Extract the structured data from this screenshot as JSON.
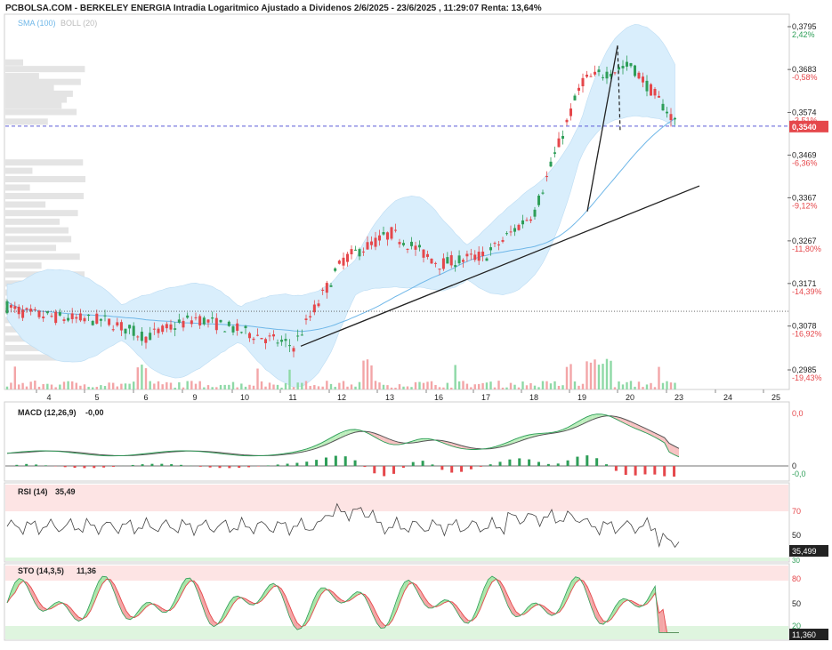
{
  "header": {
    "title": "PCBOLSA.COM - BERKELEY ENERGIA Intradia Logaritmico Ajustado a Dividenos 2/6/2025 - 23/6/2025 , 11:29:07 Renta: 13,64%",
    "sma_label": "SMA (100)",
    "boll_label": "BOLL (20)"
  },
  "colors": {
    "up": "#2e9e58",
    "down": "#e5474b",
    "boll_fill": "#d9eefc",
    "sma": "#6fb7e8",
    "negative_text": "#e5474b",
    "positive_text": "#2e9e58",
    "price_badge": "#e5474b"
  },
  "price_axis": {
    "ticks": [
      {
        "price": "0,3795",
        "pct": "2,42%",
        "sign": "pos",
        "value": 0.3795
      },
      {
        "price": "0,3683",
        "pct": "-0,58%",
        "sign": "neg",
        "value": 0.3683
      },
      {
        "price": "0,3574",
        "pct": "-3,51%",
        "sign": "neg",
        "value": 0.3574
      },
      {
        "price": "0,3469",
        "pct": "-6,36%",
        "sign": "neg",
        "value": 0.3469
      },
      {
        "price": "0,3367",
        "pct": "-9,12%",
        "sign": "neg",
        "value": 0.3367
      },
      {
        "price": "0,3267",
        "pct": "-11,80%",
        "sign": "neg",
        "value": 0.3267
      },
      {
        "price": "0,3171",
        "pct": "-14,39%",
        "sign": "neg",
        "value": 0.3171
      },
      {
        "price": "0,3078",
        "pct": "-16,92%",
        "sign": "neg",
        "value": 0.3078
      },
      {
        "price": "0,2985",
        "pct": "-19,43%",
        "sign": "neg",
        "value": 0.2985
      }
    ],
    "last_price_label": "0,3540",
    "last_price": 0.354
  },
  "x_axis": {
    "labels": [
      "4",
      "5",
      "6",
      "9",
      "10",
      "11",
      "12",
      "13",
      "16",
      "17",
      "18",
      "19",
      "20",
      "23",
      "24",
      "25"
    ]
  },
  "macd": {
    "label": "MACD (12,26,9)",
    "value": "-0,00",
    "axis_top": "0,0",
    "axis_zero": "0",
    "badge": "-0,0"
  },
  "rsi": {
    "label": "RSI (14)",
    "value": "35,49",
    "level_70": "70",
    "level_50": "50",
    "level_30": "30",
    "badge": "35,499"
  },
  "sto": {
    "label": "STO (14,3,5)",
    "value": "11,36",
    "level_80": "80",
    "level_50": "50",
    "level_20": "20",
    "badge": "11,360"
  },
  "chart_data": [
    {
      "type": "candlestick",
      "title": "PCBOLSA.COM - BERKELEY ENERGIA Intradia Logaritmico Ajustado a Dividenos 2/6/2025 - 23/6/2025 , 11:29:07 Renta: 13,64%",
      "scale": "log",
      "ylim": [
        0.2985,
        0.3795
      ],
      "x_categories": [
        "4",
        "5",
        "6",
        "9",
        "10",
        "11",
        "12",
        "13",
        "16",
        "17",
        "18",
        "19",
        "20",
        "23",
        "24",
        "25"
      ],
      "last_price": 0.354,
      "reference_line": 0.311,
      "session_path": [
        {
          "x": "3",
          "close": 0.312
        },
        {
          "x": "4",
          "close": 0.3105
        },
        {
          "x": "5",
          "close": 0.3095
        },
        {
          "x": "6",
          "close": 0.309
        },
        {
          "x": "9",
          "close": 0.3055
        },
        {
          "x": "10",
          "close": 0.3095
        },
        {
          "x": "11",
          "close": 0.3065
        },
        {
          "x": "12",
          "close": 0.3035
        },
        {
          "x": "13",
          "close": 0.3225
        },
        {
          "x": "16",
          "close": 0.3285
        },
        {
          "x": "17",
          "close": 0.3215
        },
        {
          "x": "18",
          "close": 0.3235
        },
        {
          "x": "19",
          "close": 0.3335
        },
        {
          "x": "20",
          "close": 0.3655
        },
        {
          "x": "23",
          "close": 0.3695
        },
        {
          "x": "23 (11:29)",
          "close": 0.354
        }
      ],
      "overlays": [
        "SMA (100)",
        "BOLL (20)"
      ],
      "grid": false
    },
    {
      "type": "line",
      "title": "MACD (12,26,9)",
      "last_value": -0.0,
      "ylim_label": "0,0"
    },
    {
      "type": "line",
      "title": "RSI (14)",
      "last_value": 35.499,
      "levels": [
        30,
        50,
        70
      ]
    },
    {
      "type": "line",
      "title": "STO (14,3,5)",
      "last_value": 11.36,
      "levels": [
        20,
        50,
        80
      ]
    }
  ]
}
